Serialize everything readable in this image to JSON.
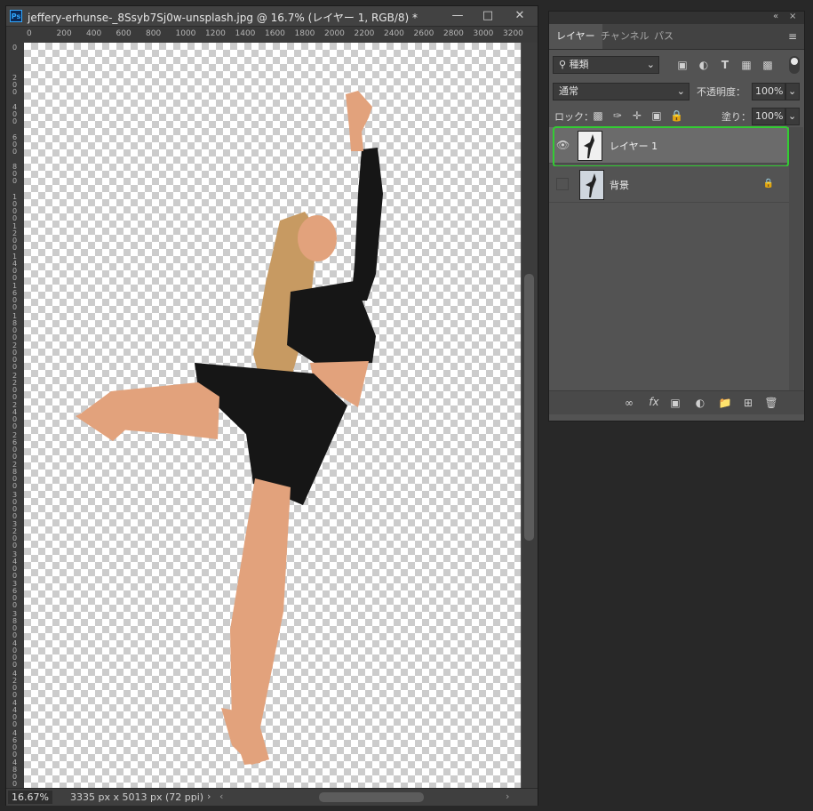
{
  "document": {
    "title": "jeffery-erhunse-_8Ssyb7Sj0w-unsplash.jpg @ 16.7% (レイヤー 1, RGB/8) *",
    "ps_icon_label": "Ps",
    "ruler_top_ticks": [
      "0",
      "200",
      "400",
      "600",
      "800",
      "1000",
      "1200",
      "1400",
      "1600",
      "1800",
      "2000",
      "2200",
      "2400",
      "2600",
      "2800",
      "3000",
      "3200"
    ],
    "ruler_left_ticks": [
      "0",
      "2\n0\n0",
      "4\n0\n0",
      "6\n0\n0",
      "8\n0\n0",
      "1\n0\n0\n0",
      "1\n2\n0\n0",
      "1\n4\n0\n0",
      "1\n6\n0\n0",
      "1\n8\n0\n0",
      "2\n0\n0\n0",
      "2\n2\n0\n0",
      "2\n4\n0\n0",
      "2\n6\n0\n0",
      "2\n8\n0\n0",
      "3\n0\n0\n0",
      "3\n2\n0\n0",
      "3\n4\n0\n0",
      "3\n6\n0\n0",
      "3\n8\n0\n0",
      "4\n0\n0\n0",
      "4\n2\n0\n0",
      "4\n4\n0\n0",
      "4\n6\n0\n0",
      "4\n8\n0\n0"
    ],
    "zoom": "16.67%",
    "doc_size": "3335 px x 5013 px (72 ppi)"
  },
  "panel": {
    "tabs": [
      "レイヤー",
      "チャンネル",
      "パス"
    ],
    "filter_kind": "種類",
    "blend_mode": "通常",
    "opacity_label": "不透明度：",
    "opacity_value": "100%",
    "lock_label": "ロック：",
    "fill_label": "塗り：",
    "fill_value": "100%",
    "layers": [
      {
        "name": "レイヤー 1",
        "visible": true,
        "selected": true
      },
      {
        "name": "背景",
        "visible": false,
        "locked": true
      }
    ],
    "fx_label": "fx"
  },
  "colors": {
    "highlight": "#33cc33",
    "skin": "#e2a27c",
    "clothing": "#161616",
    "hair": "#c79a62"
  }
}
